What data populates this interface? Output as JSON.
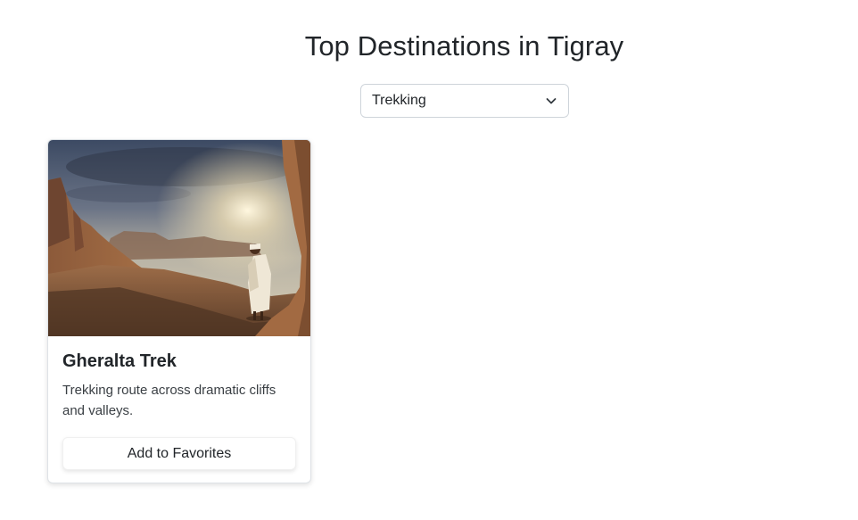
{
  "header": {
    "title": "Top Destinations in Tigray"
  },
  "filter": {
    "selected": "Trekking",
    "icon": "chevron-down-icon"
  },
  "destinations": [
    {
      "title": "Gheralta Trek",
      "description": "Trekking route across dramatic cliffs and valleys.",
      "button_label": "Add to Favorites"
    }
  ]
}
